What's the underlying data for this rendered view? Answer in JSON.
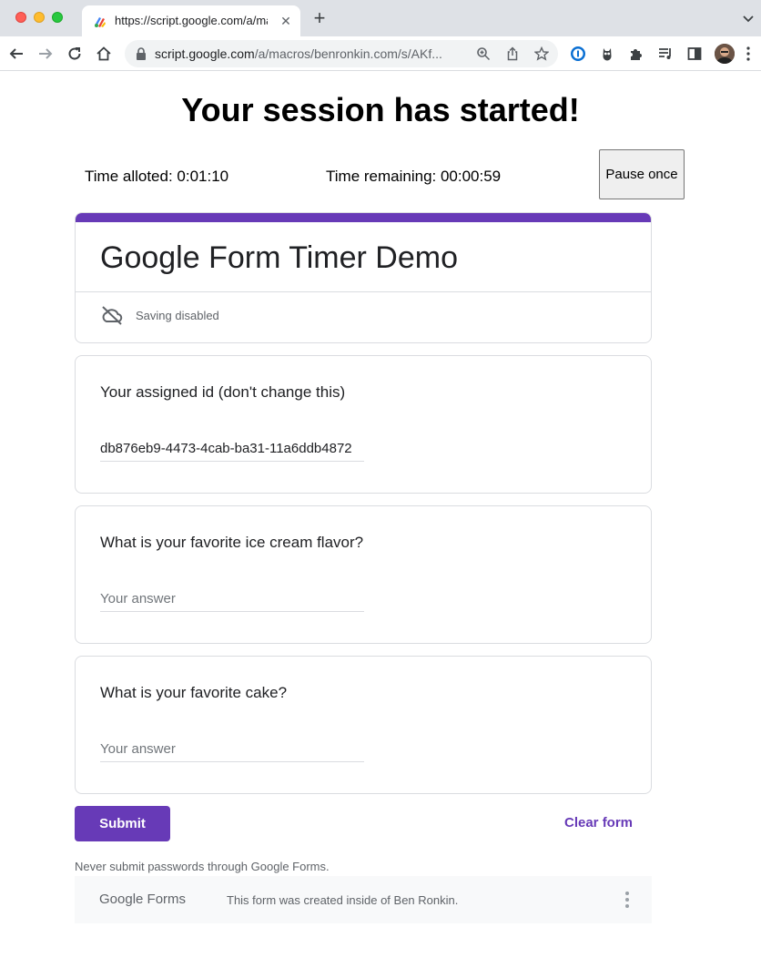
{
  "browser": {
    "tab_title": "https://script.google.com/a/ma",
    "tab_close": "✕",
    "new_tab": "+",
    "url_host": "script.google.com",
    "url_path": "/a/macros/benronkin.com/s/AKf..."
  },
  "session": {
    "title": "Your session has started!",
    "time_allotted": "Time alloted: 0:01:10",
    "time_remaining": "Time remaining: 00:00:59",
    "pause_label": "Pause once"
  },
  "form": {
    "title": "Google Form Timer Demo",
    "saving_status": "Saving disabled",
    "accent_color": "#673ab7",
    "questions": [
      {
        "title": "Your assigned id (don't change this)",
        "value": "db876eb9-4473-4cab-ba31-11a6ddb4872",
        "placeholder": ""
      },
      {
        "title": "What is your favorite ice cream flavor?",
        "value": "",
        "placeholder": "Your answer"
      },
      {
        "title": "What is your favorite cake?",
        "value": "",
        "placeholder": "Your answer"
      }
    ],
    "submit_label": "Submit",
    "clear_label": "Clear form",
    "warning": "Never submit passwords through Google Forms.",
    "footer_logo": "Google Forms",
    "footer_text": "This form was created inside of Ben Ronkin."
  }
}
